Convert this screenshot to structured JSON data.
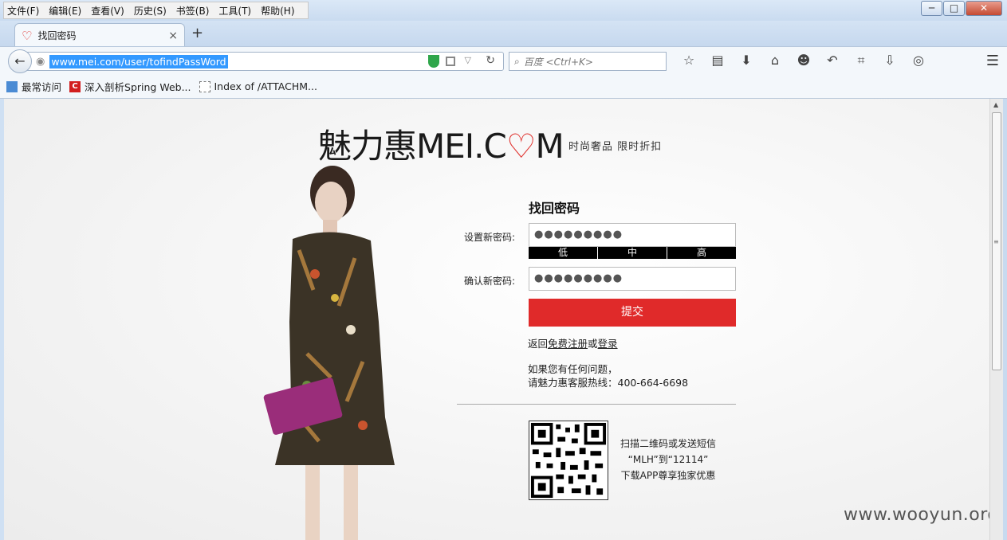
{
  "menubar": {
    "items": [
      "文件(F)",
      "编辑(E)",
      "查看(V)",
      "历史(S)",
      "书签(B)",
      "工具(T)",
      "帮助(H)"
    ]
  },
  "window_buttons": {
    "minimize": "─",
    "maximize": "□",
    "close": "✕"
  },
  "tab": {
    "title": "找回密码",
    "close": "×",
    "new_tab": "+"
  },
  "navbar": {
    "url": "www.mei.com/user/tofindPassWord",
    "search_placeholder": "百度 <Ctrl+K>"
  },
  "bookmarks": [
    {
      "label": "最常访问",
      "icon": "most-visited-icon"
    },
    {
      "label": "深入剖析Spring Web...",
      "icon": "c-icon"
    },
    {
      "label": "Index of /ATTACHM...",
      "icon": "blank-page-icon"
    }
  ],
  "page": {
    "logo_cn": "魅力惠",
    "logo_en_1": "MEI.C",
    "logo_en_2": "M",
    "tagline": "时尚奢品 限时折扣",
    "form_title": "找回密码",
    "new_password_label": "设置新密码:",
    "new_password_value": "●●●●●●●●●",
    "strength": [
      "低",
      "中",
      "高"
    ],
    "confirm_password_label": "确认新密码:",
    "confirm_password_value": "●●●●●●●●●",
    "submit": "提交",
    "back_prefix": "返回",
    "register_link": "免费注册",
    "or": "或",
    "login_link": "登录",
    "help_line1": "如果您有任何问题，",
    "help_line2": "请魅力惠客服热线：400-664-6698",
    "qr_line1": "扫描二维码或发送短信",
    "qr_line2": "“MLH”到“12114”",
    "qr_line3": "下载APP尊享独家优惠"
  },
  "watermark": "www.wooyun.org",
  "colors": {
    "accent": "#e02a2a",
    "url_highlight": "#3399ff"
  }
}
